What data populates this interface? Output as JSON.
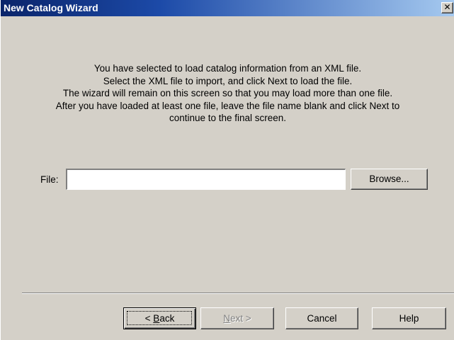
{
  "window": {
    "title": "New Catalog Wizard",
    "close_glyph": "✕"
  },
  "instructions": {
    "lines": [
      "You have selected to load catalog information from an XML file.",
      "Select the XML file to import, and click Next to load the file.",
      "The wizard will remain on this screen so that you may load more than one file.",
      "After you have loaded at least one file, leave the file name blank and click Next to",
      "continue to the final screen."
    ]
  },
  "file": {
    "label": "File:",
    "value": "",
    "browse_label": "Browse..."
  },
  "buttons": {
    "back_prefix": "< ",
    "back_mnemonic": "B",
    "back_rest": "ack",
    "next_mnemonic": "N",
    "next_rest": "ext >",
    "cancel": "Cancel",
    "help": "Help"
  },
  "colors": {
    "title_bar_start": "#0a246a",
    "title_bar_end": "#a6caf0",
    "face": "#d4d0c8",
    "disabled_text": "#808080"
  }
}
